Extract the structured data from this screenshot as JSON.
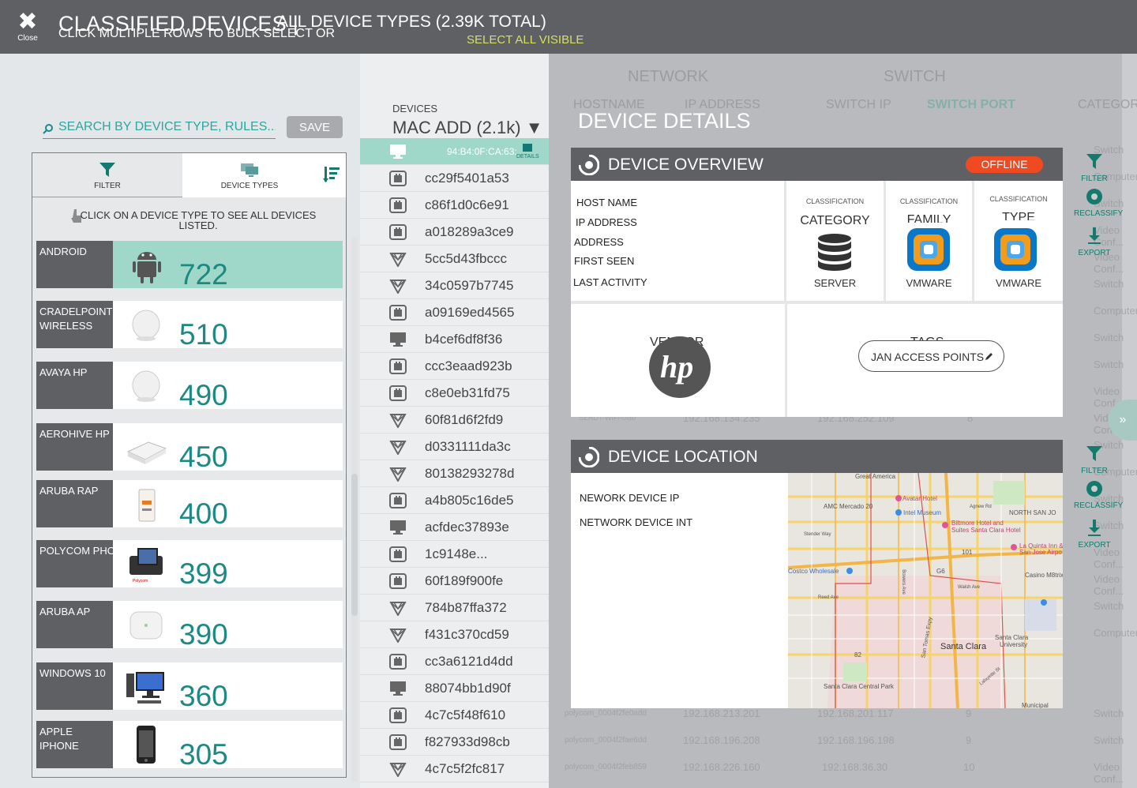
{
  "topbar": {
    "close_label": "Close",
    "title": "CLASSIFIED DEVICES |",
    "subtitle": "ALL DEVICE TYPES (2.39K TOTAL)",
    "hint": "CLICK MULTIPLE ROWS TO BULK SELECT OR",
    "select_all": "SELECT ALL VISIBLE"
  },
  "search": {
    "placeholder": "SEARCH BY DEVICE TYPE, RULES...",
    "save_label": "SAVE"
  },
  "tabs": {
    "filter": "FILTER",
    "device_types": "DEVICE TYPES"
  },
  "hint_text": "CLICK ON A DEVICE TYPE TO SEE ALL DEVICES LISTED.",
  "device_types": [
    {
      "name": "ANDROID",
      "count": "722",
      "icon": "android-icon"
    },
    {
      "name": "CRADELPOINT WIRELESS",
      "count": "510",
      "icon": "access-point-icon"
    },
    {
      "name": "AVAYA HP",
      "count": "490",
      "icon": "access-point-icon"
    },
    {
      "name": "AEROHIVE HP",
      "count": "450",
      "icon": "router-icon"
    },
    {
      "name": "ARUBA RAP",
      "count": "400",
      "icon": "remote-ap-icon"
    },
    {
      "name": "POLYCOM PHONE",
      "count": "399",
      "icon": "ip-phone-icon"
    },
    {
      "name": "ARUBA AP",
      "count": "390",
      "icon": "access-point-icon"
    },
    {
      "name": "WINDOWS 10",
      "count": "360",
      "icon": "desktop-pc-icon"
    },
    {
      "name": "APPLE IPHONE",
      "count": "305",
      "icon": "iphone-icon"
    }
  ],
  "middle": {
    "label": "DEVICES",
    "sort": "MAC ADD (2.1k) ▼",
    "details_label": "DETAILS",
    "rows": [
      {
        "mac": "94:B4:0F:CA:63:",
        "icon": "monitor-icon"
      },
      {
        "mac": "cc29f5401a53",
        "icon": "device-icon"
      },
      {
        "mac": "c86f1d0c6e91",
        "icon": "device-icon"
      },
      {
        "mac": "a018289a3ce9",
        "icon": "device-icon"
      },
      {
        "mac": "5cc5d43fbccc",
        "icon": "mesh-icon"
      },
      {
        "mac": "34c0597b7745",
        "icon": "mesh-icon"
      },
      {
        "mac": "a09169ed4565",
        "icon": "device-icon"
      },
      {
        "mac": "b4cef6df8f36",
        "icon": "monitor-icon"
      },
      {
        "mac": "ccc3eaad923b",
        "icon": "device-icon"
      },
      {
        "mac": "c8e0eb31fd75",
        "icon": "device-icon"
      },
      {
        "mac": "60f81d6f2fd9",
        "icon": "mesh-icon"
      },
      {
        "mac": "d0331111da3c",
        "icon": "mesh-icon"
      },
      {
        "mac": "80138293278d",
        "icon": "mesh-icon"
      },
      {
        "mac": "a4b805c16de5",
        "icon": "device-icon"
      },
      {
        "mac": "acfdec37893e",
        "icon": "monitor-icon"
      },
      {
        "mac": "1c9148e...",
        "icon": "device-icon"
      },
      {
        "mac": "60f189f900fe",
        "icon": "device-icon"
      },
      {
        "mac": "784b87ffa372",
        "icon": "mesh-icon"
      },
      {
        "mac": "f431c370cd59",
        "icon": "mesh-icon"
      },
      {
        "mac": "cc3a6121d4dd",
        "icon": "device-icon"
      },
      {
        "mac": "88074bb1d90f",
        "icon": "monitor-icon"
      },
      {
        "mac": "4c7c5f48f610",
        "icon": "device-icon"
      },
      {
        "mac": "f827933d98cb",
        "icon": "device-icon"
      },
      {
        "mac": "4c7c5f2fc817",
        "icon": "mesh-icon"
      }
    ]
  },
  "bg_table": {
    "group_network": "NETWORK",
    "group_switch": "SWITCH",
    "col_hostname": "HOSTNAME",
    "col_ip": "IP ADDRESS",
    "col_switch_ip": "SWITCH IP",
    "col_switch_port": "SWITCH PORT",
    "col_category": "CATEGORY",
    "rows": [
      {
        "host": "SERDT-WIFI-0f8b",
        "ip": "192.168.134.235",
        "sw": "192.168.252.109",
        "port": "8",
        "cat": "Video Conf..."
      },
      {
        "host": "polycom_0004f2fe0add",
        "ip": "192.168.213.201",
        "sw": "192.168.201.117",
        "port": "9",
        "cat": "Switch"
      },
      {
        "host": "polycom_0004f2fae6dd",
        "ip": "192.168.196.208",
        "sw": "192.168.196.198",
        "port": "9",
        "cat": "Switch"
      },
      {
        "host": "polycom_0004f2feb859",
        "ip": "192.168.226.160",
        "sw": "192.168.36.30",
        "port": "10",
        "cat": "Video Conf..."
      }
    ],
    "right_categories": [
      "Switch",
      "Computer",
      "Switch",
      "Video Conf...",
      "Video Conf...",
      "Switch",
      "Computer",
      "Switch",
      "Switch",
      "Video Conf...",
      "Video Conf...",
      "Switch",
      "Computer",
      "Switch",
      "Switch",
      "Video Conf...",
      "Video Conf...",
      "Switch",
      "Computer"
    ]
  },
  "device_details": {
    "title": "DEVICE DETAILS",
    "overview": {
      "heading": "DEVICE OVERVIEW",
      "status": "OFFLINE",
      "fields": [
        "HOST NAME",
        "IP ADDRESS",
        "ADDRESS",
        "FIRST SEEN",
        "LAST ACTIVITY"
      ],
      "classification_label": "CLASSIFICATION",
      "category_label": "CATEGORY",
      "category_value": "SERVER",
      "family_label": "FAMILY",
      "family_value": "VMWARE",
      "type_label": "TYPE",
      "type_value": "VMWARE",
      "vendor_label": "VENDOR",
      "vendor_logo": "hp",
      "tags_label": "TAGS",
      "tag": "JAN ACCESS POINTS"
    },
    "location": {
      "heading": "DEVICE LOCATION",
      "fields": [
        "NEWORK DEVICE IP",
        "NETWORK DEVICE INT"
      ],
      "map_labels": [
        "Great America",
        "Avatar Hotel",
        "AMC Mercado 20",
        "Intel Museum",
        "NORTH SAN JO",
        "Biltmore Hotel and",
        "Suites Santa Clara Hotel",
        "La Quinta Inn &",
        "San Jose Airpo",
        "Costco Wholesale",
        "Casino M8trix",
        "Santa Clara",
        "Santa Clara",
        "University",
        "Santa Clara Central Park",
        "Municipal",
        "Stender Way",
        "Walsh Ave",
        "Bowers Ave",
        "San Tomas Expy",
        "Agnew Rd",
        "101",
        "G6",
        "82",
        "Reed Ave",
        "Lafayette St"
      ]
    }
  },
  "rail": {
    "filter": "FILTER",
    "reclassify": "RECLASSIFY",
    "export": "EXPORT"
  },
  "colors": {
    "topbar": "#5e6064",
    "accent": "#1c8a82",
    "active_row": "#9fd8c8",
    "offline": "#f04a22",
    "select_all": "#d8df62"
  }
}
